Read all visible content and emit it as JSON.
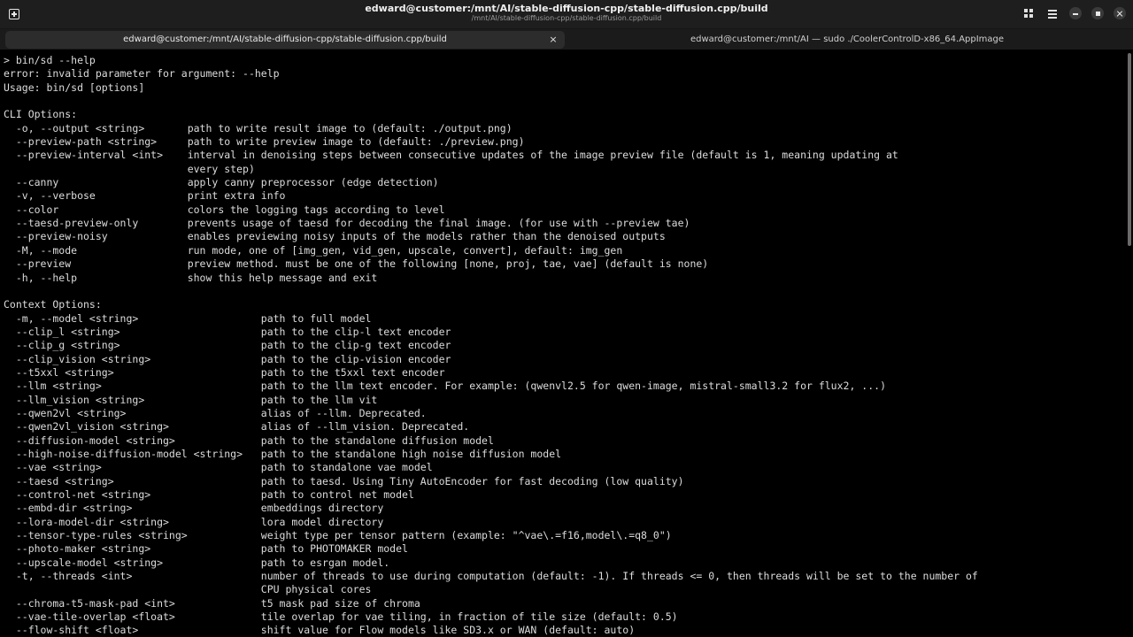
{
  "window": {
    "title": "edward@customer:/mnt/AI/stable-diffusion-cpp/stable-diffusion.cpp/build",
    "subtitle": "/mnt/AI/stable-diffusion-cpp/stable-diffusion.cpp/build"
  },
  "tabs": [
    {
      "label": "edward@customer:/mnt/AI/stable-diffusion-cpp/stable-diffusion.cpp/build",
      "close": "×"
    },
    {
      "label": "edward@customer:/mnt/AI — sudo ./CoolerControlD-x86_64.AppImage"
    }
  ],
  "icons": {
    "new_tab": "new-tab-icon",
    "grid": "grid-icon",
    "menu": "menu-icon",
    "minimize": "minimize-icon",
    "maximize": "maximize-icon",
    "close": "close-icon"
  },
  "colors": {
    "terminal_bg": "#000000",
    "text": "#dcdcdc",
    "titlebar": "#1e1e1e",
    "active_tab": "#2c2c2c"
  },
  "terminal": {
    "lines": [
      "> bin/sd --help",
      "error: invalid parameter for argument: --help",
      "Usage: bin/sd [options]",
      "",
      "CLI Options:",
      "  -o, --output <string>       path to write result image to (default: ./output.png)",
      "  --preview-path <string>     path to write preview image to (default: ./preview.png)",
      "  --preview-interval <int>    interval in denoising steps between consecutive updates of the image preview file (default is 1, meaning updating at",
      "                              every step)",
      "  --canny                     apply canny preprocessor (edge detection)",
      "  -v, --verbose               print extra info",
      "  --color                     colors the logging tags according to level",
      "  --taesd-preview-only        prevents usage of taesd for decoding the final image. (for use with --preview tae)",
      "  --preview-noisy             enables previewing noisy inputs of the models rather than the denoised outputs",
      "  -M, --mode                  run mode, one of [img_gen, vid_gen, upscale, convert], default: img_gen",
      "  --preview                   preview method. must be one of the following [none, proj, tae, vae] (default is none)",
      "  -h, --help                  show this help message and exit",
      "",
      "Context Options:",
      "  -m, --model <string>                    path to full model",
      "  --clip_l <string>                       path to the clip-l text encoder",
      "  --clip_g <string>                       path to the clip-g text encoder",
      "  --clip_vision <string>                  path to the clip-vision encoder",
      "  --t5xxl <string>                        path to the t5xxl text encoder",
      "  --llm <string>                          path to the llm text encoder. For example: (qwenvl2.5 for qwen-image, mistral-small3.2 for flux2, ...)",
      "  --llm_vision <string>                   path to the llm vit",
      "  --qwen2vl <string>                      alias of --llm. Deprecated.",
      "  --qwen2vl_vision <string>               alias of --llm_vision. Deprecated.",
      "  --diffusion-model <string>              path to the standalone diffusion model",
      "  --high-noise-diffusion-model <string>   path to the standalone high noise diffusion model",
      "  --vae <string>                          path to standalone vae model",
      "  --taesd <string>                        path to taesd. Using Tiny AutoEncoder for fast decoding (low quality)",
      "  --control-net <string>                  path to control net model",
      "  --embd-dir <string>                     embeddings directory",
      "  --lora-model-dir <string>               lora model directory",
      "  --tensor-type-rules <string>            weight type per tensor pattern (example: \"^vae\\.=f16,model\\.=q8_0\")",
      "  --photo-maker <string>                  path to PHOTOMAKER model",
      "  --upscale-model <string>                path to esrgan model.",
      "  -t, --threads <int>                     number of threads to use during computation (default: -1). If threads <= 0, then threads will be set to the number of",
      "                                          CPU physical cores",
      "  --chroma-t5-mask-pad <int>              t5 mask pad size of chroma",
      "  --vae-tile-overlap <float>              tile overlap for vae tiling, in fraction of tile size (default: 0.5)",
      "  --flow-shift <float>                    shift value for Flow models like SD3.x or WAN (default: auto)"
    ]
  }
}
